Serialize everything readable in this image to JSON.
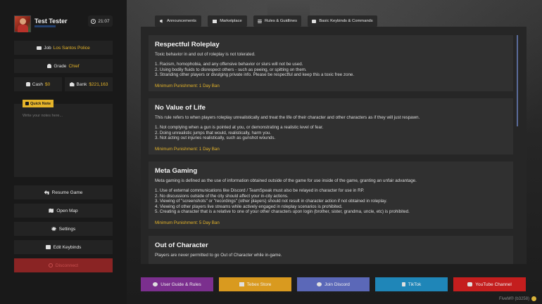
{
  "profile": {
    "name": "Test Tester",
    "time": "21:07"
  },
  "job": {
    "label": "Job",
    "value": "Los Santos Police"
  },
  "grade": {
    "label": "Grade",
    "value": "Chief"
  },
  "cash": {
    "label": "Cash",
    "value": "$0"
  },
  "bank": {
    "label": "Bank",
    "value": "$221,163"
  },
  "notes": {
    "button_label": "Quick Note",
    "placeholder": "Write your notes here..."
  },
  "menu": {
    "resume": "Resume Game",
    "map": "Open Map",
    "settings": "Settings",
    "keybinds": "Edit Keybinds",
    "disconnect": "Disconnect"
  },
  "tabs": [
    {
      "label": "Announcements",
      "icon": "megaphone-icon"
    },
    {
      "label": "Marketplace",
      "icon": "store-icon"
    },
    {
      "label": "Rules & Guidlines",
      "icon": "list-icon"
    },
    {
      "label": "Basic Keybinds & Commands",
      "icon": "keyboard-icon"
    }
  ],
  "rules": [
    {
      "title": "Respectful Roleplay",
      "desc": "Toxic behavior in and out of roleplay is not tolerated.",
      "items": [
        "1. Racism, homophobia, and any offensive behavior or slurs will not be used.",
        "2. Using bodily fluids to disrespect others - such as peeing, or spitting on them.",
        "3. Stranding other players or divulging private info. Please be respectful and keep this a toxic free zone."
      ],
      "punishment": "Minimum Punishment: 1 Day Ban"
    },
    {
      "title": "No Value of Life",
      "desc": "This rule refers to when players roleplay unrealistically and treat the life of their character and other characters as if they will just respawn.",
      "items": [
        "1. Not complying when a gun is pointed at you, or demonstrating a realistic level of fear.",
        "2. Doing unrealistic jumps that would, realistically, harm you.",
        "3. Not acting out injuries realistically, such as gunshot wounds."
      ],
      "punishment": "Minimum Punishment: 1 Day Ban"
    },
    {
      "title": "Meta Gaming",
      "desc": "Meta gaming is defined as the use of information obtained outside of the game for use inside of the game, granting an unfair advantage.",
      "items": [
        "1. Use of external communications like Discord / TeamSpeak must also be relayed in character for use in RP.",
        "2. No discussions outside of the city should affect your in-city actions.",
        "3. Viewing of \"screenshots\" or \"recordings\" (other players) should not result in character action if not obtained in roleplay.",
        "4. Viewing of other players live streams while actively engaged in roleplay scenarios is prohibited.",
        "5. Creating a character that is a relative to one of your other characters upon login (brother, sister, grandma, uncle, etc) is prohibited."
      ],
      "punishment": "Minimum Punishment: 5 Day Ban"
    },
    {
      "title": "Out of Character",
      "desc": "Players are never permitted to go Out of Character while in-game.",
      "items": [],
      "punishment": ""
    }
  ],
  "footer": [
    {
      "label": "User Guide & Rules",
      "icon": "github-icon",
      "color": "#7b2f8e"
    },
    {
      "label": "Tebex Store",
      "icon": "store-icon",
      "color": "#d99a1f"
    },
    {
      "label": "Join Discord",
      "icon": "discord-icon",
      "color": "#5b68b8"
    },
    {
      "label": "TikTok",
      "icon": "tiktok-icon",
      "color": "#1f86b8"
    },
    {
      "label": "YouTube Channel",
      "icon": "youtube-icon",
      "color": "#c41e1e"
    }
  ],
  "watermark": "FiveM® (b3258)"
}
